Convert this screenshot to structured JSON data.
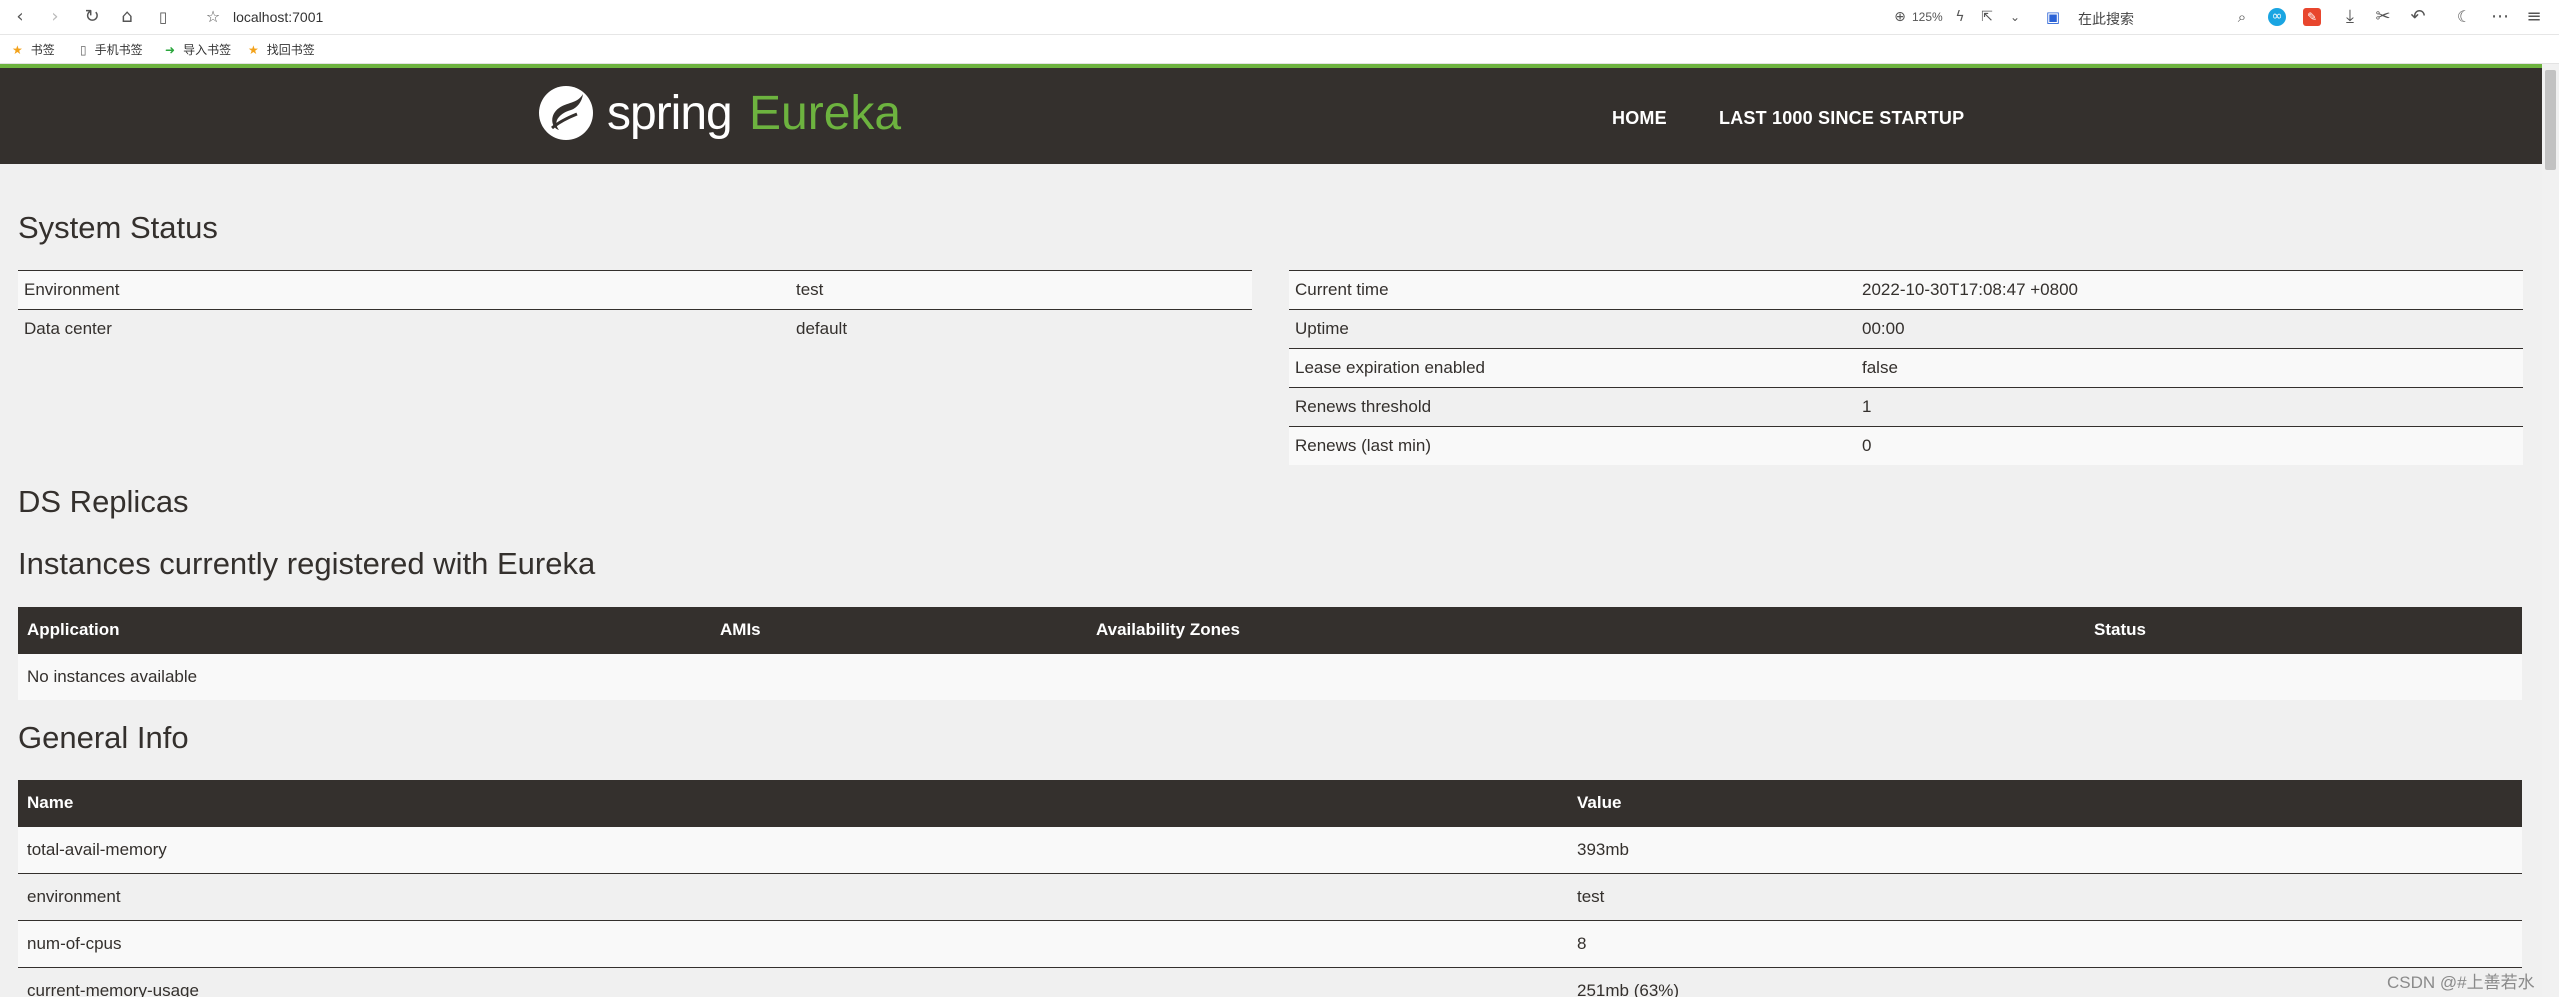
{
  "browser": {
    "url": "localhost:7001",
    "zoom": "125%",
    "search_placeholder": "在此搜索",
    "bookmarks": [
      "书签",
      "手机书签",
      "导入书签",
      "找回书签"
    ]
  },
  "navbar": {
    "logo_spring": "spring",
    "logo_eureka": "Eureka",
    "links": [
      "HOME",
      "LAST 1000 SINCE STARTUP"
    ]
  },
  "system_status": {
    "title": "System Status",
    "left": [
      {
        "label": "Environment",
        "value": "test"
      },
      {
        "label": "Data center",
        "value": "default"
      }
    ],
    "right": [
      {
        "label": "Current time",
        "value": "2022-10-30T17:08:47 +0800"
      },
      {
        "label": "Uptime",
        "value": "00:00"
      },
      {
        "label": "Lease expiration enabled",
        "value": "false"
      },
      {
        "label": "Renews threshold",
        "value": "1"
      },
      {
        "label": "Renews (last min)",
        "value": "0"
      }
    ]
  },
  "ds_replicas": {
    "title": "DS Replicas"
  },
  "instances": {
    "title": "Instances currently registered with Eureka",
    "headers": [
      "Application",
      "AMIs",
      "Availability Zones",
      "Status"
    ],
    "empty_message": "No instances available"
  },
  "general_info": {
    "title": "General Info",
    "headers": [
      "Name",
      "Value"
    ],
    "rows": [
      {
        "name": "total-avail-memory",
        "value": "393mb"
      },
      {
        "name": "environment",
        "value": "test"
      },
      {
        "name": "num-of-cpus",
        "value": "8"
      },
      {
        "name": "current-memory-usage",
        "value": "251mb (63%)"
      }
    ]
  },
  "watermark": "CSDN @#上善若水",
  "colors": {
    "navbar": "#34302d",
    "brand_green": "#6db33f",
    "background": "#f0f0f0"
  }
}
